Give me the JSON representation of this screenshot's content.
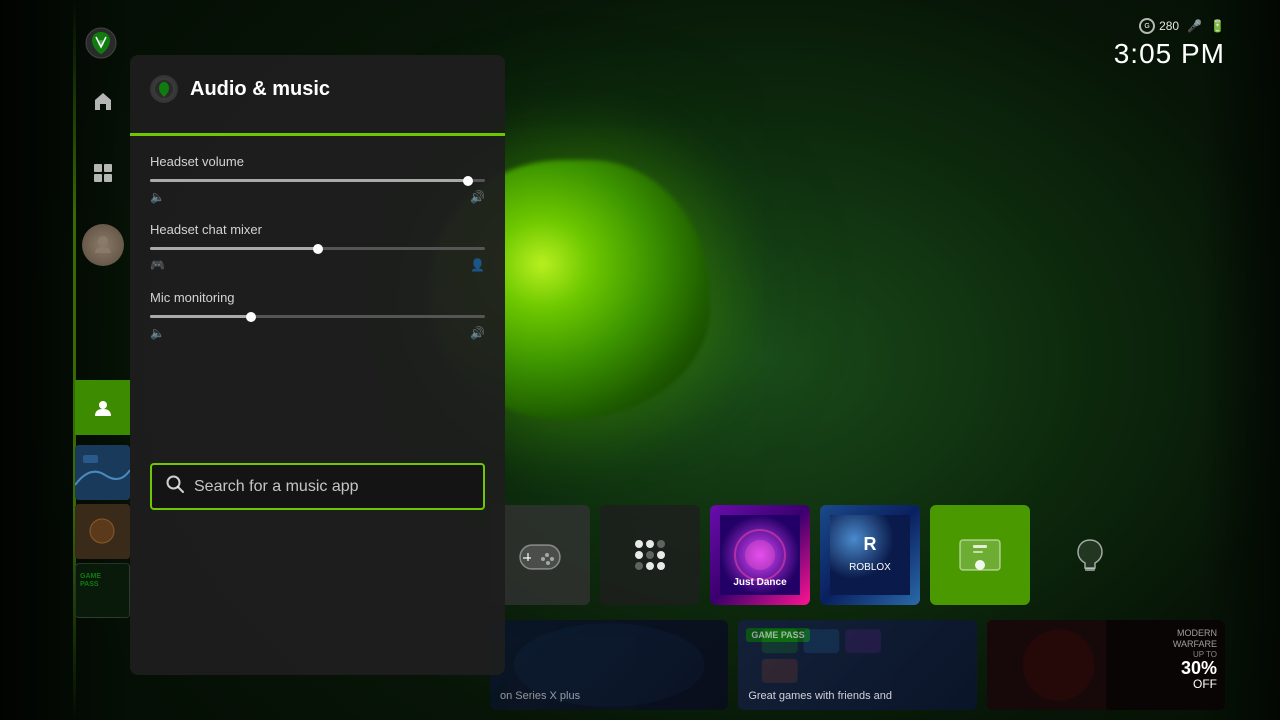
{
  "background": {
    "color": "#0a1a0a"
  },
  "statusBar": {
    "gamerscore": "280",
    "time": "3:05 PM",
    "micIcon": "🎤",
    "batteryIcon": "🔋"
  },
  "panel": {
    "title": "Audio & music",
    "sections": [
      {
        "label": "Headset volume",
        "sliderValue": 95,
        "iconLeft": "🔈",
        "iconRight": "🔊"
      },
      {
        "label": "Headset chat mixer",
        "sliderValue": 50,
        "iconLeft": "🎮",
        "iconRight": "👤"
      },
      {
        "label": "Mic monitoring",
        "sliderValue": 30,
        "iconLeft": "🔈",
        "iconRight": "🔊"
      }
    ],
    "searchPlaceholder": "Search for a music app"
  },
  "sidebar": {
    "items": [
      {
        "id": "home",
        "icon": "⌂",
        "active": false
      },
      {
        "id": "media",
        "icon": "▦",
        "active": false
      },
      {
        "id": "avatar",
        "icon": "👤",
        "active": false
      },
      {
        "id": "active-item",
        "icon": "🎵",
        "active": true
      }
    ]
  },
  "taskbar": {
    "tiles": [
      {
        "id": "controller",
        "type": "controller",
        "label": ""
      },
      {
        "id": "spinner",
        "type": "spinner",
        "label": ""
      },
      {
        "id": "game1",
        "type": "game",
        "label": "Just Dance"
      },
      {
        "id": "game2",
        "type": "game",
        "label": "Roblox"
      },
      {
        "id": "xbox-green",
        "type": "green",
        "label": ""
      },
      {
        "id": "light",
        "type": "light",
        "label": "💡"
      }
    ]
  },
  "banners": [
    {
      "id": "dark-banner",
      "text": "on Series X plus"
    },
    {
      "id": "gamepass-banner",
      "badge": "GAME PASS",
      "text": "Great games with friends and"
    },
    {
      "id": "cod-banner",
      "title": "MODERN\nWARFARE",
      "discount": "30%",
      "off": "OFF"
    }
  ]
}
